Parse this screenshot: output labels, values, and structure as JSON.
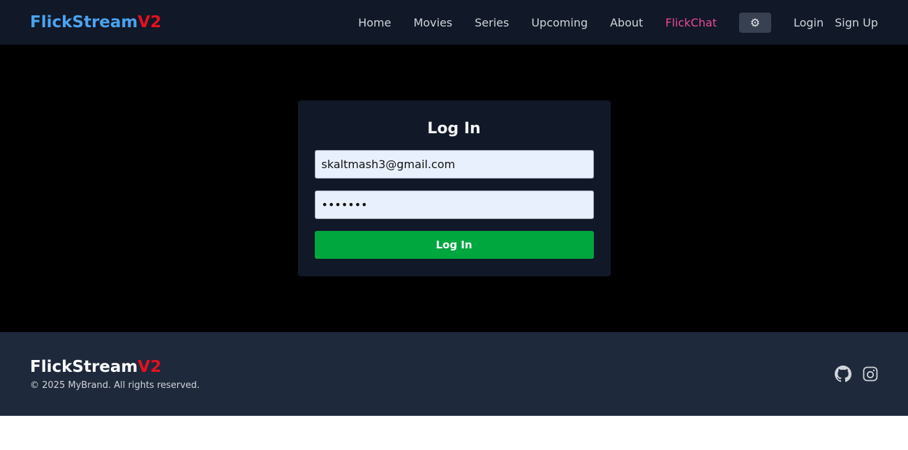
{
  "brand": {
    "name": "FlickStream",
    "suffix": "V2"
  },
  "nav": {
    "items": [
      "Home",
      "Movies",
      "Series",
      "Upcoming",
      "About"
    ],
    "chat": "FlickChat",
    "login": "Login",
    "signup": "Sign Up",
    "theme_icon": "gear-icon"
  },
  "form": {
    "title": "Log In",
    "email": "skaltmash3@gmail.com",
    "password": "abcdefg",
    "submit": "Log In"
  },
  "footer": {
    "copyright": "© 2025 MyBrand. All rights reserved.",
    "icons": [
      "github-icon",
      "instagram-icon"
    ]
  },
  "colors": {
    "accent": "#4aa3f0",
    "brand_red": "#e5101f",
    "chat": "#ec4899",
    "submit": "#00a63e"
  }
}
